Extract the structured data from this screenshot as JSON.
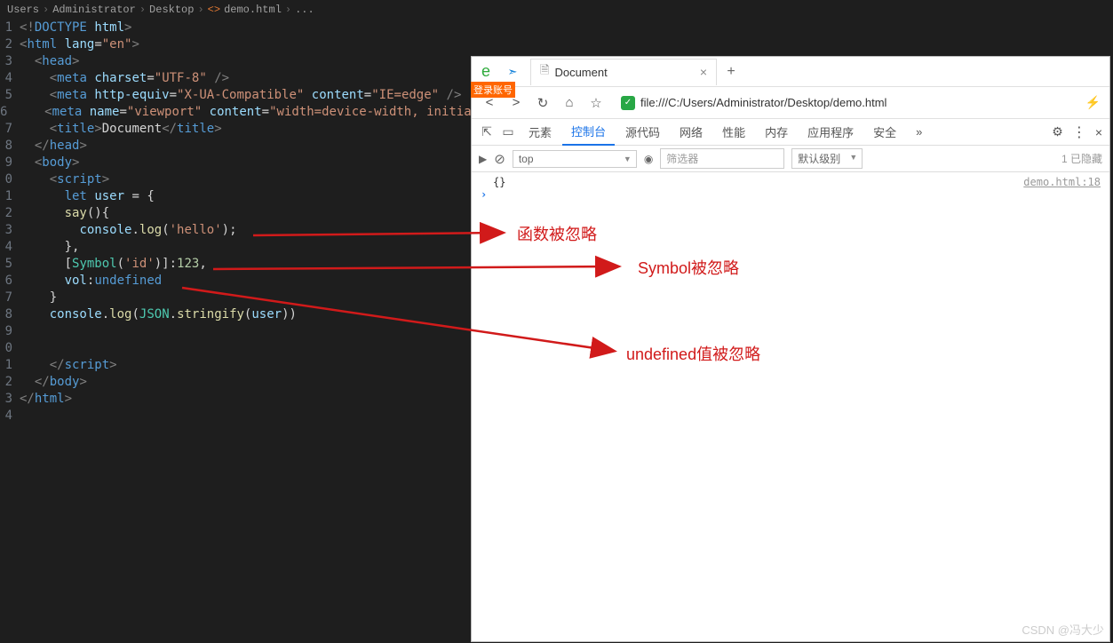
{
  "breadcrumb": {
    "p0": "Users",
    "p1": "Administrator",
    "p2": "Desktop",
    "p3": "demo.html",
    "p4": "..."
  },
  "code": {
    "l1": "<!DOCTYPE html>",
    "l2": "<html lang=\"en\">",
    "l3": "  <head>",
    "l4": "    <meta charset=\"UTF-8\" />",
    "l5": "    <meta http-equiv=\"X-UA-Compatible\" content=\"IE=edge\" />",
    "l6": "    <meta name=\"viewport\" content=\"width=device-width, initial-sc",
    "l7": "    <title>Document</title>",
    "l8": "  </head>",
    "l9": "  <body>",
    "l10": "    <script>",
    "l11": "      let user = {",
    "l12": "      say(){",
    "l13": "        console.log('hello');",
    "l14": "      },",
    "l15": "      [Symbol('id')]:123,",
    "l16": "      vol:undefined",
    "l17": "    }",
    "l18": "    console.log(JSON.stringify(user))",
    "l21": "    </script>",
    "l22": "  </body>",
    "l23": "</html>"
  },
  "browser": {
    "login_badge": "登录账号",
    "tab_title": "Document",
    "url": "file:///C:/Users/Administrator/Desktop/demo.html",
    "devtools": {
      "tabs": {
        "elements": "元素",
        "console": "控制台",
        "sources": "源代码",
        "network": "网络",
        "performance": "性能",
        "memory": "内存",
        "application": "应用程序",
        "security": "安全",
        "more": "»"
      },
      "context": "top",
      "filter_placeholder": "筛选器",
      "level": "默认级别",
      "hidden": "1 已隐藏",
      "output": "{}",
      "src_link": "demo.html:18"
    }
  },
  "annotations": {
    "a1": "函数被忽略",
    "a2": "Symbol被忽略",
    "a3": "undefined值被忽略"
  },
  "watermark": "CSDN @冯大少"
}
